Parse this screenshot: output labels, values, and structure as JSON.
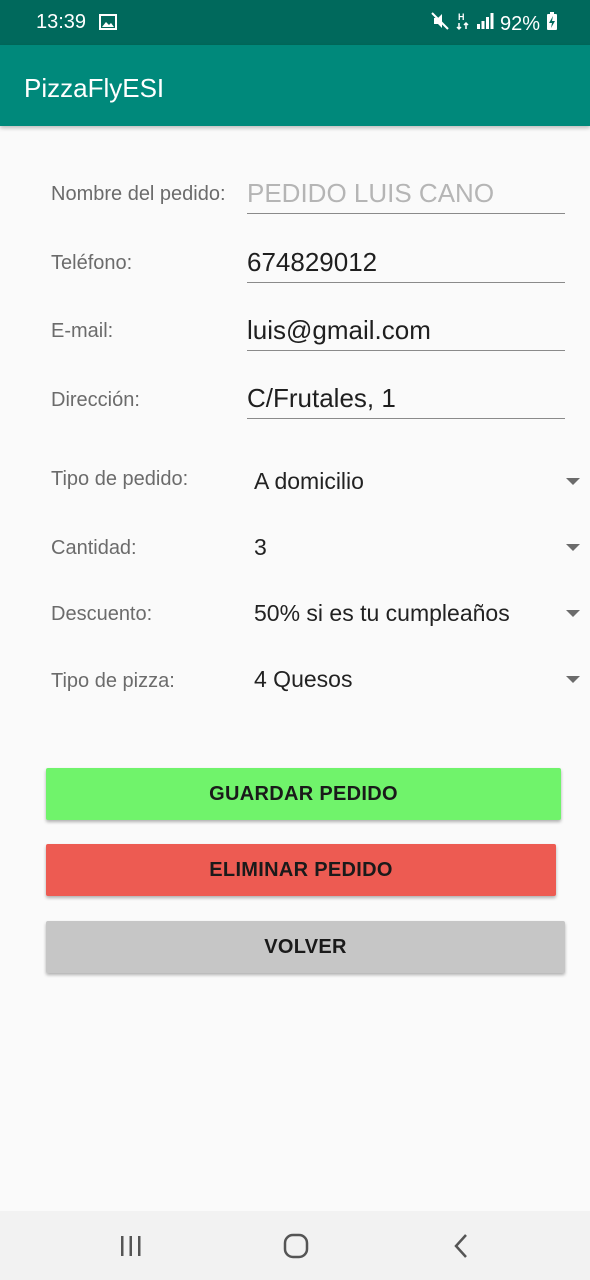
{
  "status_bar": {
    "time": "13:39",
    "battery": "92%"
  },
  "app_bar": {
    "title": "PizzaFlyESI"
  },
  "form": {
    "nombre": {
      "label": "Nombre del pedido:",
      "placeholder": "PEDIDO LUIS CANO"
    },
    "telefono": {
      "label": "Teléfono:",
      "value": "674829012"
    },
    "email": {
      "label": "E-mail:",
      "value": "luis@gmail.com"
    },
    "direccion": {
      "label": "Dirección:",
      "value": "C/Frutales, 1"
    },
    "tipo_pedido": {
      "label": "Tipo de pedido:",
      "selected": "A domicilio"
    },
    "cantidad": {
      "label": "Cantidad:",
      "selected": "3"
    },
    "descuento": {
      "label": "Descuento:",
      "selected": "50% si es tu cumpleaños"
    },
    "tipo_pizza": {
      "label": "Tipo de pizza:",
      "selected": "4 Quesos"
    }
  },
  "buttons": {
    "guardar": {
      "label": "GUARDAR PEDIDO",
      "color": "#70f36b"
    },
    "eliminar": {
      "label": "ELIMINAR PEDIDO",
      "color": "#ed5b52"
    },
    "volver": {
      "label": "VOLVER",
      "color": "#c6c6c6"
    }
  },
  "icons": {
    "status": [
      "image-icon",
      "mute-icon",
      "data-icon",
      "signal-icon",
      "battery-charging-icon"
    ],
    "nav": [
      "recents-icon",
      "home-icon",
      "back-icon"
    ]
  }
}
